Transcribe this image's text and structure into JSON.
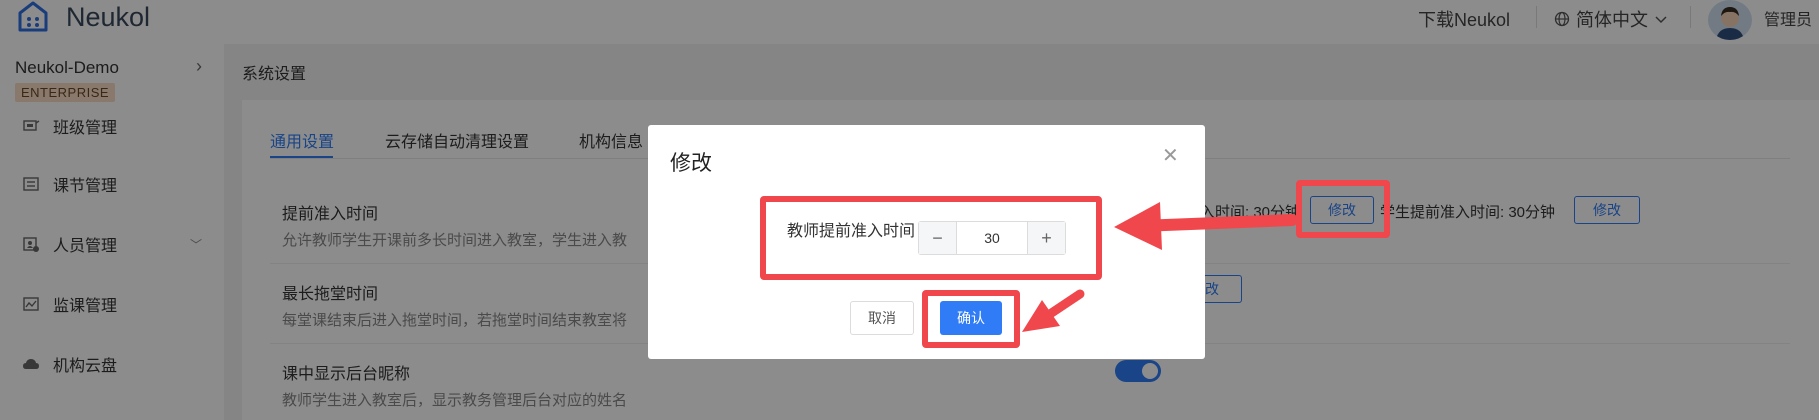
{
  "header": {
    "brand": "Neukol",
    "download": "下载Neukol",
    "language": "简体中文",
    "user": "管理员"
  },
  "sidebar": {
    "org_name": "Neukol-Demo",
    "org_badge": "ENTERPRISE",
    "items": [
      {
        "label": "班级管理",
        "icon": "classroom-icon"
      },
      {
        "label": "课节管理",
        "icon": "lesson-icon"
      },
      {
        "label": "人员管理",
        "icon": "people-icon"
      },
      {
        "label": "监课管理",
        "icon": "monitor-icon"
      },
      {
        "label": "机构云盘",
        "icon": "cloud-icon"
      }
    ]
  },
  "breadcrumb": "系统设置",
  "tabs": [
    "通用设置",
    "云存储自动清理设置",
    "机构信息"
  ],
  "settings": [
    {
      "title": "提前准入时间",
      "desc": "允许教师学生开课前多长时间进入教室，学生进入教",
      "value_teacher": "入时间: 30分钟",
      "value_student": "学生提前准入时间: 30分钟",
      "edit_label": "修改"
    },
    {
      "title": "最长拖堂时间",
      "desc": "每堂课结束后进入拖堂时间，若拖堂时间结束教室将",
      "edit_label": "改"
    },
    {
      "title": "课中显示后台昵称",
      "desc": "教师学生进入教室后，显示教务管理后台对应的姓名"
    }
  ],
  "modal": {
    "title": "修改",
    "field_label": "教师提前准入时间",
    "value": "30",
    "minus": "−",
    "plus": "+",
    "cancel": "取消",
    "confirm": "确认"
  },
  "colors": {
    "primary": "#2f7cf6",
    "annotation": "#f0474c"
  }
}
